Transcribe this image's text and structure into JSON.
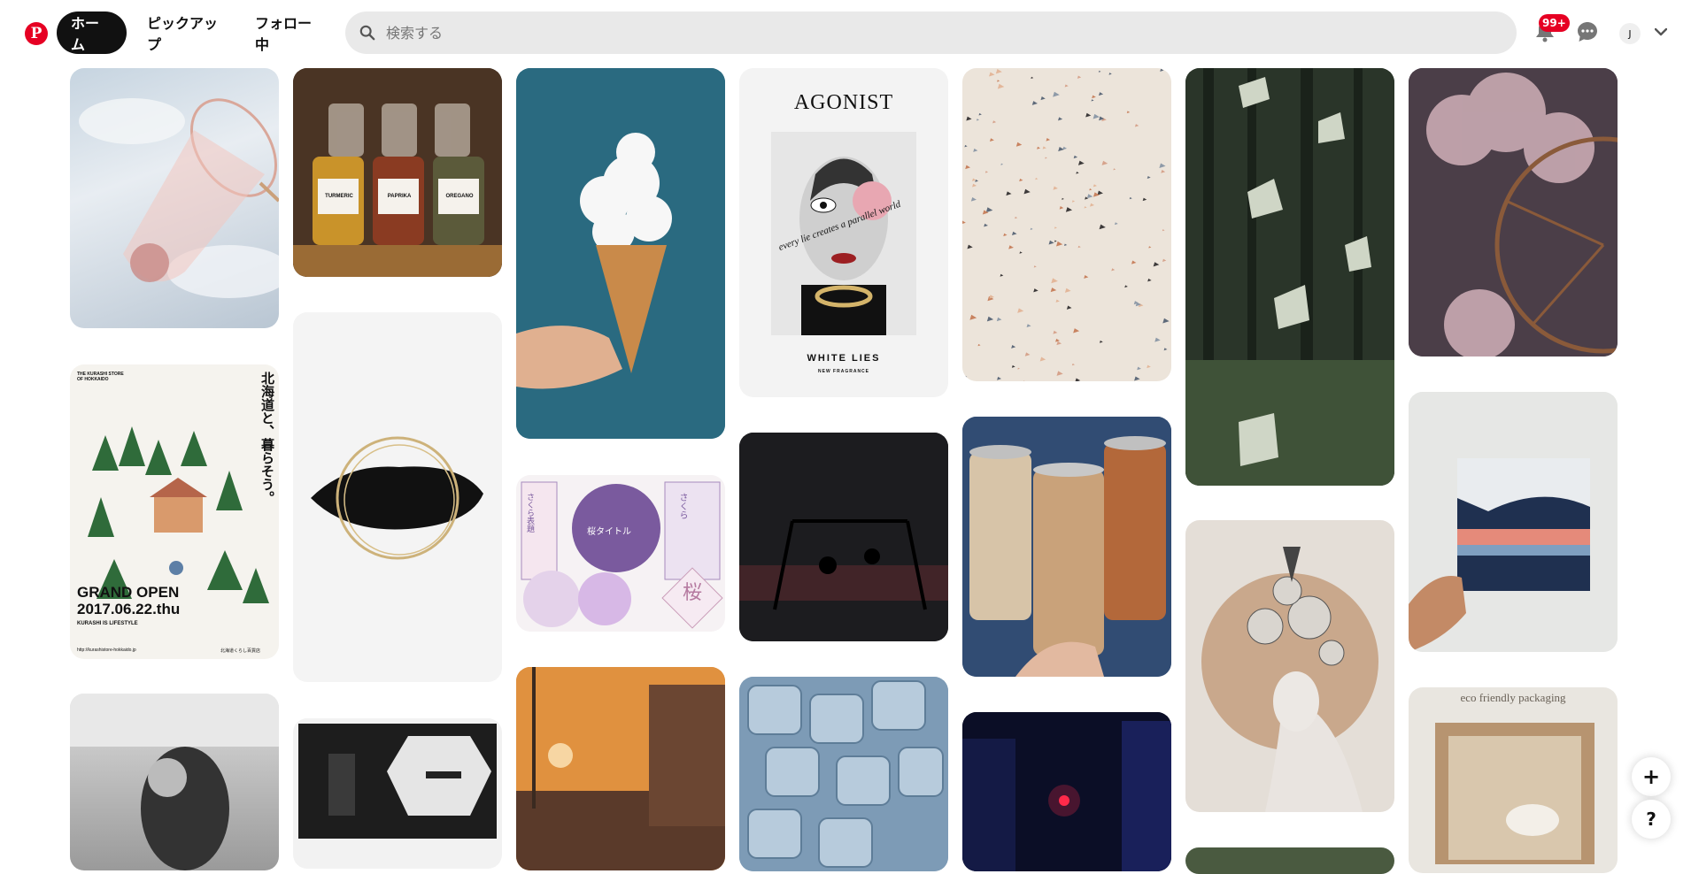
{
  "header": {
    "logo": "P",
    "tabs": [
      {
        "label": "ホーム"
      },
      {
        "label": "ピックアップ"
      },
      {
        "label": "フォロー中"
      }
    ],
    "search": {
      "placeholder": "検索する",
      "value": ""
    },
    "notifications_badge": "99+",
    "avatar_initial": "J"
  },
  "pins": {
    "agonist": {
      "brand": "AGONIST",
      "script": "every lie creates a parallel world",
      "product": "WHITE LIES",
      "sub": "NEW FRAGRANCE"
    },
    "spices": {
      "labels": [
        "TURMERIC",
        "PAPRIKA",
        "OREGANO"
      ]
    },
    "kurashi": {
      "header": "THE KURASHI STORE OF HOKKAIDO",
      "vertical": "北海道と、暮らそう。",
      "open": "GRAND OPEN",
      "date": "2017.06.22.thu",
      "tagline": "KURASHI IS LIFESTYLE",
      "url": "http://kurashistore-hokkaido.jp",
      "store": "北海道くらし百貨店"
    },
    "sakura": {
      "texts": [
        "さくら表題",
        "桜タイトル",
        "さくら",
        "桜"
      ]
    },
    "eco": {
      "label": "eco friendly packaging"
    }
  },
  "floating": {
    "add": "+",
    "help": "?"
  },
  "colors": {
    "brand": "#e60023",
    "active_tab_bg": "#111111",
    "search_bg": "#e9e9e9"
  }
}
